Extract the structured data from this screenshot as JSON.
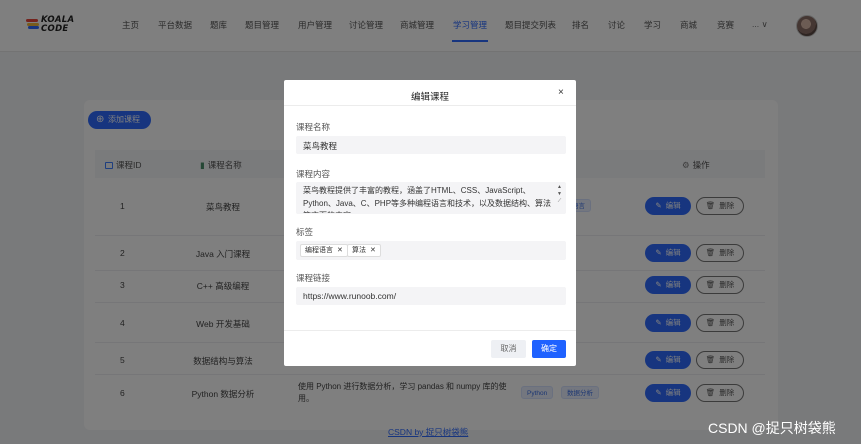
{
  "brand": {
    "line1": "KOALA",
    "line2": "CODE",
    "colors": [
      "#e8473a",
      "#f2b93b",
      "#2f6bff"
    ]
  },
  "nav": {
    "items": [
      "主页",
      "平台数据",
      "题库",
      "题目管理",
      "用户管理",
      "讨论管理",
      "商城管理",
      "学习管理",
      "题目提交列表",
      "排名",
      "讨论",
      "学习",
      "商城",
      "竞赛"
    ],
    "active": "学习管理",
    "more": "... ∨"
  },
  "toolbar": {
    "add_label": "添加课程"
  },
  "table": {
    "headers": {
      "id": "课程ID",
      "name": "课程名称",
      "actions": "操作"
    },
    "rows": [
      {
        "id": "1",
        "name": "菜鸟教程",
        "tags": [
          "语言"
        ]
      },
      {
        "id": "2",
        "name": "Java 入门课程",
        "tags": []
      },
      {
        "id": "3",
        "name": "C++ 高级编程",
        "tags": []
      },
      {
        "id": "4",
        "name": "Web 开发基础",
        "tags": []
      },
      {
        "id": "5",
        "name": "数据结构与算法",
        "tags": []
      },
      {
        "id": "6",
        "name": "Python 数据分析",
        "desc": "使用 Python 进行数据分析，学习 pandas 和 numpy 库的使用。",
        "tags": [
          "Python",
          "数据分析"
        ]
      }
    ],
    "edit_label": "编辑",
    "delete_label": "删除"
  },
  "footer": {
    "link": "CSDN by 捉只树袋熊"
  },
  "modal": {
    "title": "编辑课程",
    "close": "×",
    "name_label": "课程名称",
    "name_value": "菜鸟教程",
    "content_label": "课程内容",
    "content_value": "菜鸟教程提供了丰富的教程，涵盖了HTML、CSS、JavaScript、Python、Java、C、PHP等多种编程语言和技术，以及数据结构、算法等方面的内容。",
    "tags_label": "标签",
    "tags": [
      "编程语言",
      "算法"
    ],
    "link_label": "课程链接",
    "link_value": "https://www.runoob.com/",
    "cancel_label": "取消",
    "ok_label": "确定"
  },
  "watermark": "CSDN @捉只树袋熊",
  "colors": {
    "primary": "#2f6bff",
    "overlay": "rgba(0,0,0,0.5)"
  }
}
